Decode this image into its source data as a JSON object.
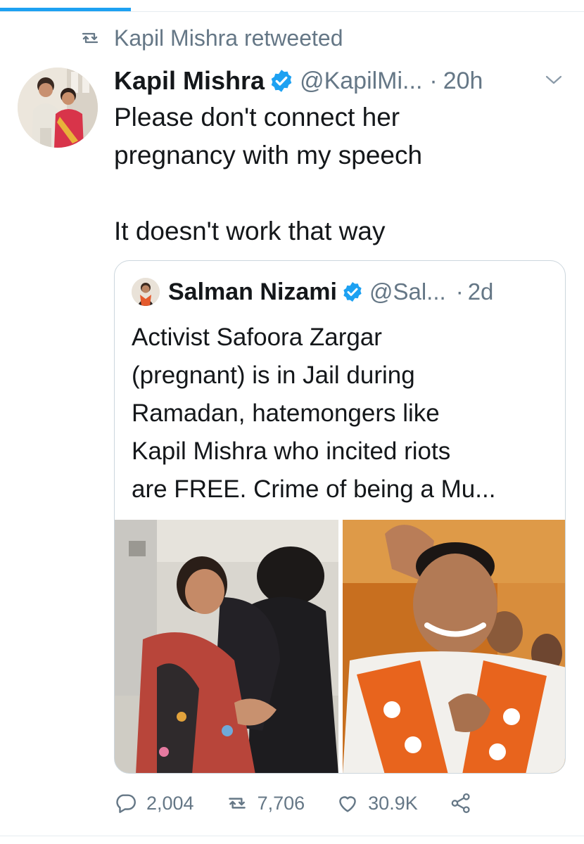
{
  "colors": {
    "accent": "#1da1f2",
    "secondary_text": "#657786",
    "primary_text": "#14171a",
    "border": "#ccd6dd"
  },
  "social_context": {
    "icon": "retweet-icon",
    "text": "Kapil Mishra retweeted"
  },
  "tweet": {
    "author_name": "Kapil Mishra",
    "verified_icon": "verified-badge-icon",
    "handle": "@KapilMi...",
    "separator": "·",
    "time": "20h",
    "menu_icon": "chevron-down-icon",
    "text_lines": [
      "Please don't connect her",
      "pregnancy with my speech",
      "It doesn't work that way"
    ]
  },
  "quote": {
    "author_name": "Salman Nizami",
    "handle": "@Sal...",
    "separator": "·",
    "time": "2d",
    "text_lines": [
      "Activist Safoora Zargar",
      "(pregnant) is in Jail during",
      "Ramadan, hatemongers like",
      "Kapil Mishra who incited riots",
      "are FREE. Crime of being a Mu..."
    ],
    "media_count": 2
  },
  "actions": {
    "reply": {
      "icon": "reply-icon",
      "count": "2,004"
    },
    "retweet": {
      "icon": "retweet-icon",
      "count": "7,706"
    },
    "like": {
      "icon": "heart-icon",
      "count": "30.9K"
    },
    "share": {
      "icon": "share-icon"
    }
  }
}
